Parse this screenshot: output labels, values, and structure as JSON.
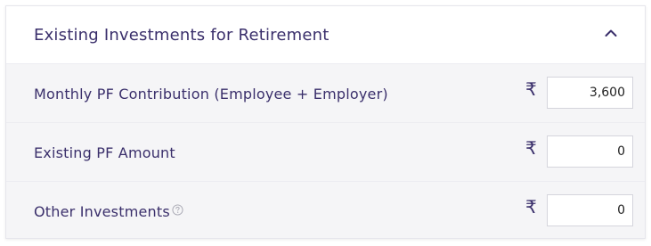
{
  "section": {
    "title": "Existing Investments for Retirement",
    "collapse_icon": "chevron-up-icon"
  },
  "currency_symbol": "₹",
  "rows": [
    {
      "label": "Monthly PF Contribution (Employee + Employer)",
      "value": "3,600"
    },
    {
      "label": "Existing PF Amount",
      "value": "0"
    },
    {
      "label": "Other Investments",
      "value": "0",
      "help_icon": "question-circle-icon"
    }
  ],
  "colors": {
    "text": "#3a2f6b",
    "row_background": "#f5f5f7",
    "input_border": "#d5d5dc"
  }
}
